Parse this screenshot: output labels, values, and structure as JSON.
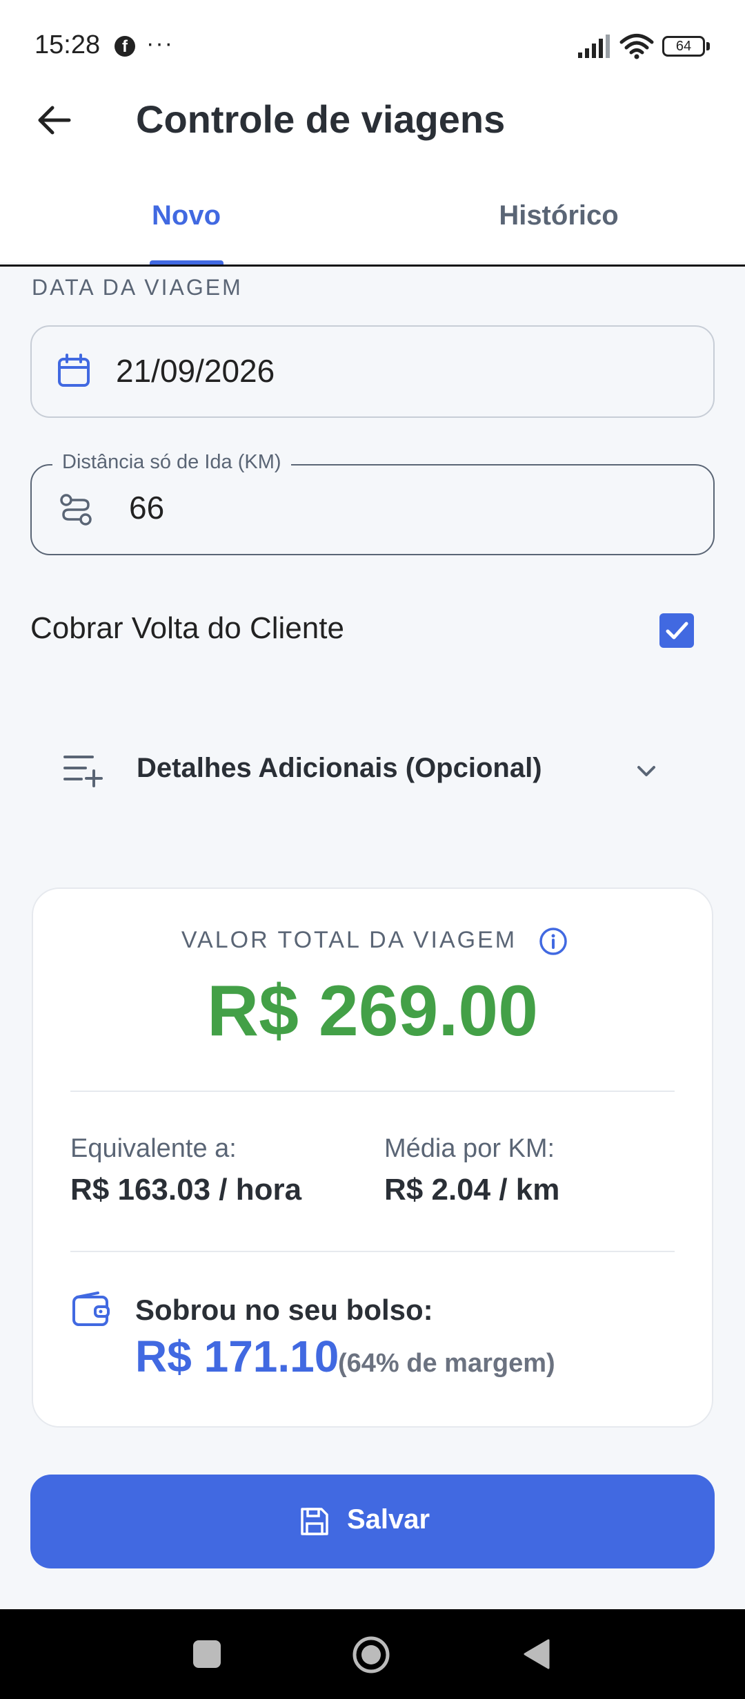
{
  "status_bar": {
    "time": "15:28",
    "dots": "···",
    "battery": "64"
  },
  "header": {
    "title": "Controle de viagens",
    "tabs": [
      {
        "label": "Novo",
        "active": true
      },
      {
        "label": "Histórico",
        "active": false
      }
    ]
  },
  "form": {
    "date_section_label": "DATA DA VIAGEM",
    "date_value": "21/09/2026",
    "distance_label": "Distância só de Ida (KM)",
    "distance_value": "66",
    "charge_return_label": "Cobrar Volta do Cliente",
    "charge_return_checked": true,
    "details_label": "Detalhes Adicionais (Opcional)"
  },
  "summary": {
    "title": "VALOR TOTAL DA VIAGEM",
    "total": "R$ 269.00",
    "hourly_label": "Equivalente a:",
    "hourly_value": "R$ 163.03 / hora",
    "per_km_label": "Média por KM:",
    "per_km_value": "R$ 2.04 / km",
    "pocket_label": "Sobrou no seu bolso:",
    "pocket_value": "R$ 171.10",
    "margin_text": "(64% de margem)"
  },
  "actions": {
    "save_label": "Salvar"
  },
  "colors": {
    "accent": "#4169e1",
    "total_green": "#43a047",
    "text_muted": "#5a6575"
  },
  "icons": {
    "back": "arrow-left-icon",
    "date": "calendar-icon",
    "distance": "route-icon",
    "details": "list-add-icon",
    "expand": "chevron-down-icon",
    "info": "info-icon",
    "wallet": "wallet-icon",
    "save": "floppy-disk-icon"
  }
}
